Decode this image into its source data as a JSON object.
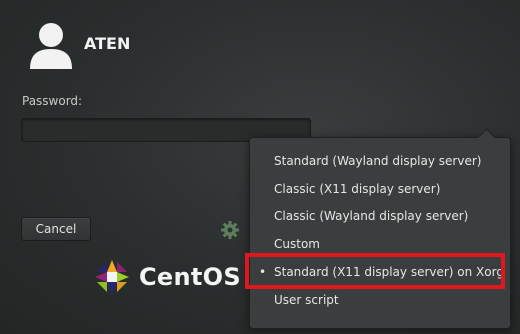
{
  "user": {
    "name": "ATEN"
  },
  "password": {
    "label": "Password:",
    "value": "",
    "placeholder": ""
  },
  "buttons": {
    "cancel": "Cancel"
  },
  "branding": {
    "logo_text": "CentOS"
  },
  "session_menu": {
    "items": [
      {
        "label": "Standard (Wayland display server)",
        "selected": false
      },
      {
        "label": "Classic (X11 display server)",
        "selected": false
      },
      {
        "label": "Classic (Wayland display server)",
        "selected": false
      },
      {
        "label": "Custom",
        "selected": false
      },
      {
        "label": "Standard (X11 display server) on Xorg",
        "selected": true
      },
      {
        "label": "User script",
        "selected": false
      }
    ],
    "selected_marker": "•"
  },
  "colors": {
    "background": "#2d3030",
    "menu_background": "#3b3e3e",
    "highlight_border": "#e0171e"
  }
}
